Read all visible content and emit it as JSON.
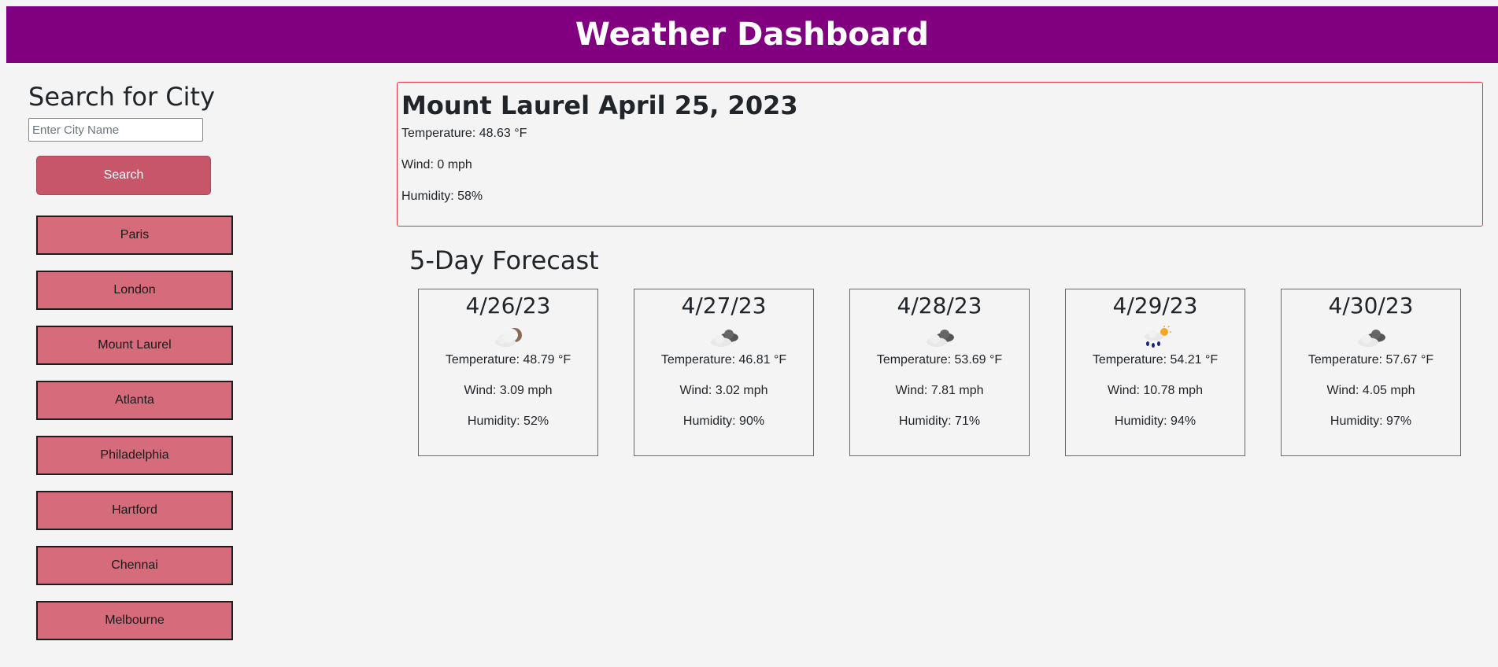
{
  "header": {
    "title": "Weather Dashboard"
  },
  "sidebar": {
    "title": "Search for City",
    "input_placeholder": "Enter City Name",
    "input_value": "",
    "search_label": "Search",
    "history": [
      "Paris",
      "London",
      "Mount Laurel",
      "Atlanta",
      "Philadelphia",
      "Hartford",
      "Chennai",
      "Melbourne"
    ]
  },
  "current": {
    "heading": "Mount Laurel April 25, 2023",
    "temperature": "Temperature: 48.63 °F",
    "wind": "Wind: 0 mph",
    "humidity": "Humidity: 58%"
  },
  "forecast": {
    "title": "5-Day Forecast",
    "days": [
      {
        "date": "4/26/23",
        "icon": "cloud-night-icon",
        "temperature": "Temperature: 48.79 °F",
        "wind": "Wind: 3.09 mph",
        "humidity": "Humidity: 52%"
      },
      {
        "date": "4/27/23",
        "icon": "broken-clouds-icon",
        "temperature": "Temperature: 46.81 °F",
        "wind": "Wind: 3.02 mph",
        "humidity": "Humidity: 90%"
      },
      {
        "date": "4/28/23",
        "icon": "broken-clouds-icon",
        "temperature": "Temperature: 53.69 °F",
        "wind": "Wind: 7.81 mph",
        "humidity": "Humidity: 71%"
      },
      {
        "date": "4/29/23",
        "icon": "rain-sun-icon",
        "temperature": "Temperature: 54.21 °F",
        "wind": "Wind: 10.78 mph",
        "humidity": "Humidity: 94%"
      },
      {
        "date": "4/30/23",
        "icon": "broken-clouds-icon",
        "temperature": "Temperature: 57.67 °F",
        "wind": "Wind: 4.05 mph",
        "humidity": "Humidity: 97%"
      }
    ]
  },
  "colors": {
    "header_bg": "#800080",
    "search_button": "#c8566a",
    "history_button": "#d66b7b",
    "card_border": "#dc3545"
  }
}
